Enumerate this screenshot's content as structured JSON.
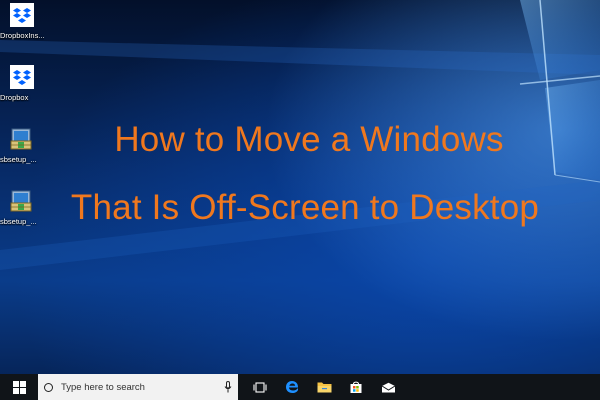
{
  "desktop": {
    "icons": [
      {
        "label": "DropboxIns...",
        "icon": "dropbox-installer-icon"
      },
      {
        "label": "Dropbox",
        "icon": "dropbox-icon"
      },
      {
        "label": "sbsetup_...",
        "icon": "setup-package-icon"
      },
      {
        "label": "sbsetup_...",
        "icon": "setup-package-icon"
      }
    ],
    "headline": {
      "line1": "How to Move a Windows",
      "line2": "That Is Off-Screen to Desktop"
    }
  },
  "taskbar": {
    "search_placeholder": "Type here to search",
    "buttons": [
      {
        "name": "task-view",
        "icon": "task-view-icon"
      },
      {
        "name": "edge",
        "icon": "edge-icon"
      },
      {
        "name": "file-explorer",
        "icon": "folder-icon"
      },
      {
        "name": "store",
        "icon": "store-icon"
      },
      {
        "name": "mail",
        "icon": "mail-icon"
      }
    ]
  },
  "colors": {
    "headline": "#f0781e",
    "taskbar": "#101418",
    "search_box": "#f2f2f2",
    "dropbox_blue": "#0061fe",
    "edge_blue": "#1e90ff",
    "folder_yellow": "#f5c244"
  }
}
